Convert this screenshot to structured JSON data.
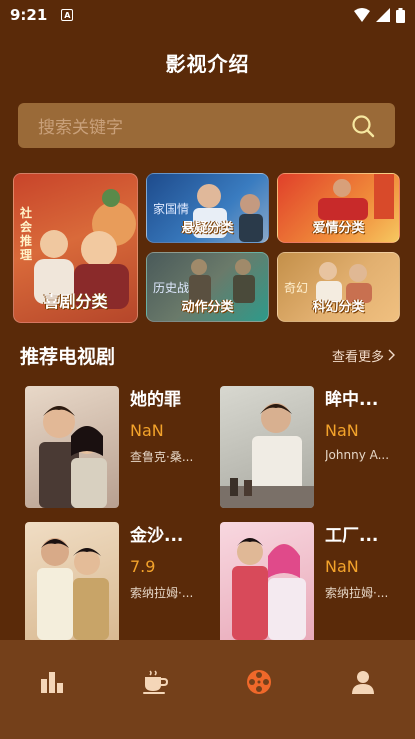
{
  "status": {
    "time": "9:21",
    "badge": "A"
  },
  "page": {
    "title": "影视介绍"
  },
  "search": {
    "placeholder": "搜索关键字"
  },
  "categories": [
    {
      "label": "喜剧分类",
      "side_text": "社会推理"
    },
    {
      "label": "悬疑分类",
      "side_text": "家国情"
    },
    {
      "label": "爱情分类",
      "side_text": ""
    },
    {
      "label": "动作分类",
      "side_text": "历史战"
    },
    {
      "label": "科幻分类",
      "side_text": "奇幻"
    }
  ],
  "section": {
    "title": "推荐电视剧",
    "more": "查看更多"
  },
  "dramas": [
    {
      "name": "她的罪",
      "score": "NaN",
      "actor": "查鲁克·桑..."
    },
    {
      "name": "眸中...",
      "score": "NaN",
      "actor": "Johnny A..."
    },
    {
      "name": "金沙...",
      "score": "7.9",
      "actor": "索纳拉姆·..."
    },
    {
      "name": "工厂...",
      "score": "NaN",
      "actor": "索纳拉姆·..."
    }
  ],
  "tabs": [
    {
      "icon": "chart-icon",
      "active": false
    },
    {
      "icon": "coffee-cup-icon",
      "active": false
    },
    {
      "icon": "film-reel-icon",
      "active": true
    },
    {
      "icon": "user-icon",
      "active": false
    }
  ],
  "colors": {
    "background": "#5a2a09",
    "accent": "#f3a32b",
    "active_tab": "#f0682a",
    "tabbar": "#74401a"
  }
}
